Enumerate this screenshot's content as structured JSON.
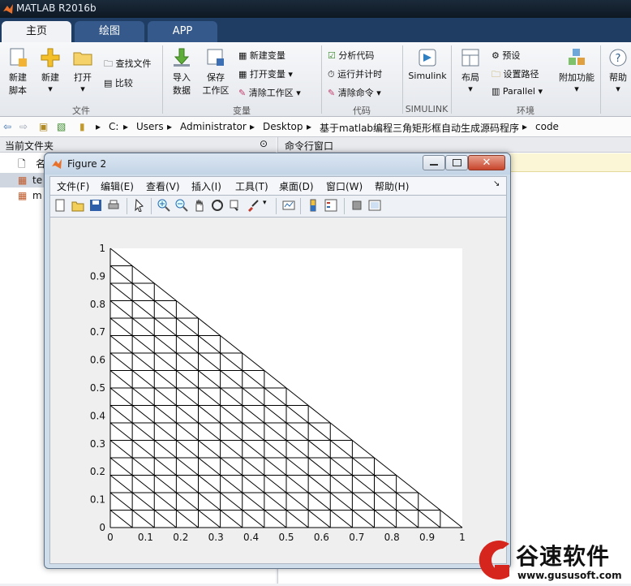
{
  "app": {
    "title": "MATLAB R2016b"
  },
  "tabs": [
    {
      "label": "主页"
    },
    {
      "label": "绘图"
    },
    {
      "label": "APP"
    }
  ],
  "ribbon": {
    "file": {
      "new_script": [
        "新建",
        "脚本"
      ],
      "new": "新建",
      "open": "打开",
      "find_files": "查找文件",
      "compare": "比较",
      "group": "文件"
    },
    "variable": {
      "import": [
        "导入",
        "数据"
      ],
      "save": [
        "保存",
        "工作区"
      ],
      "new_var": "新建变量",
      "open_var": "打开变量",
      "clear_ws": "清除工作区",
      "group": "变量"
    },
    "code": {
      "analyze": "分析代码",
      "run_time": "运行并计时",
      "clear_cmd": "清除命令",
      "group": "代码"
    },
    "simulink": {
      "label": "Simulink",
      "group": "SIMULINK"
    },
    "env": {
      "layout": "布局",
      "prefs": "预设",
      "set_path": "设置路径",
      "parallel": "Parallel",
      "addons": "附加功能",
      "group": "环境"
    },
    "help": "帮助"
  },
  "address": {
    "segments": [
      "C:",
      "Users",
      "Administrator",
      "Desktop",
      "基于matlab编程三角矩形框自动生成源码程序",
      "code"
    ]
  },
  "left_panel": {
    "title": "当前文件夹",
    "col_name": "名",
    "files": [
      "te",
      "m"
    ]
  },
  "right_panel": {
    "title": "命令行窗口"
  },
  "figure": {
    "title": "Figure 2",
    "menu": [
      "文件(F)",
      "编辑(E)",
      "查看(V)",
      "插入(I)",
      "工具(T)",
      "桌面(D)",
      "窗口(W)",
      "帮助(H)"
    ]
  },
  "chart_data": {
    "type": "line",
    "title": "",
    "xlabel": "",
    "ylabel": "",
    "xlim": [
      0,
      1
    ],
    "ylim": [
      0,
      1
    ],
    "xticks": [
      "0",
      "0.1",
      "0.2",
      "0.3",
      "0.4",
      "0.5",
      "0.6",
      "0.7",
      "0.8",
      "0.9",
      "1"
    ],
    "yticks": [
      "0",
      "0.1",
      "0.2",
      "0.3",
      "0.4",
      "0.5",
      "0.6",
      "0.7",
      "0.8",
      "0.9",
      "1"
    ],
    "mesh_divisions": 16,
    "description_shape": "right-triangle with vertices (0,0), (1,0), (0,1) subdivided into triangular mesh"
  },
  "watermark": {
    "brand": "谷速软件",
    "url": "www.gususoft.com"
  },
  "colors": {
    "tab_bg": "#1f3c63",
    "accent_red": "#d6251c"
  }
}
